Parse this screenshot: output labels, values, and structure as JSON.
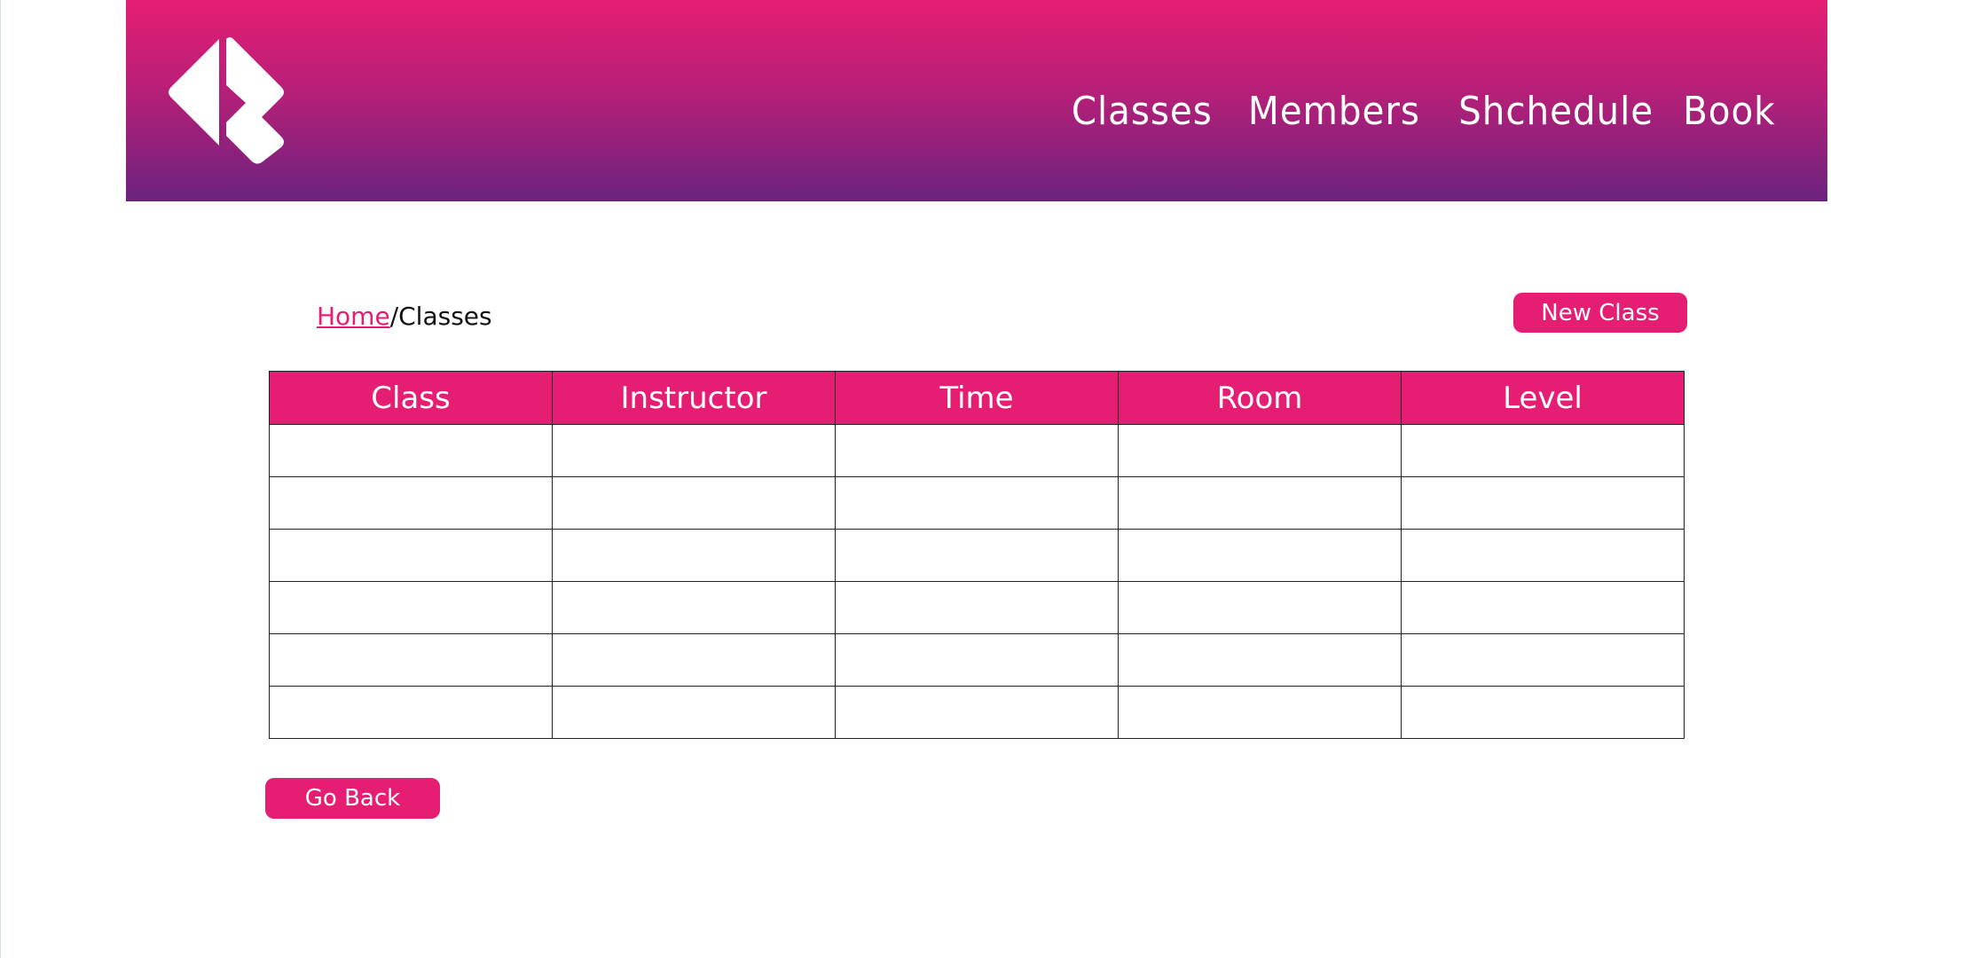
{
  "header": {
    "logo": "brand-logo-icon",
    "nav": [
      {
        "label": "Classes"
      },
      {
        "label": "Members"
      },
      {
        "label": "Shchedule"
      },
      {
        "label": "Book"
      }
    ]
  },
  "breadcrumb": {
    "home": "Home",
    "separator": "/",
    "current": "Classes"
  },
  "actions": {
    "new_class": "New Class",
    "go_back": "Go Back"
  },
  "table": {
    "columns": [
      "Class",
      "Instructor",
      "Time",
      "Room",
      "Level"
    ],
    "rows": [
      [
        "",
        "",
        "",
        "",
        ""
      ],
      [
        "",
        "",
        "",
        "",
        ""
      ],
      [
        "",
        "",
        "",
        "",
        ""
      ],
      [
        "",
        "",
        "",
        "",
        ""
      ],
      [
        "",
        "",
        "",
        "",
        ""
      ],
      [
        "",
        "",
        "",
        "",
        ""
      ]
    ]
  },
  "colors": {
    "accent": "#e61e73",
    "header_top": "#e61e73",
    "header_bottom": "#6b237f"
  }
}
